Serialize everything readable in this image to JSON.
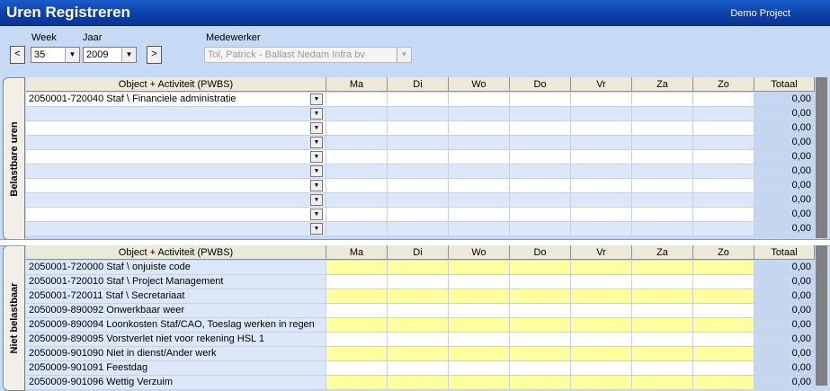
{
  "title": "Uren Registreren",
  "project": "Demo Project",
  "toolbar": {
    "week_label": "Week",
    "week_value": "35",
    "year_label": "Jaar",
    "year_value": "2009",
    "prev_label": "<",
    "next_label": ">",
    "employee_label": "Medewerker",
    "employee_value": "Tol, Patrick - Ballast Nedam Infra bv"
  },
  "columns": [
    "Object + Activiteit (PWBS)",
    "Ma",
    "Di",
    "Wo",
    "Do",
    "Vr",
    "Za",
    "Zo",
    "Totaal"
  ],
  "belastbaar": {
    "tab_label": "Belastbare uren",
    "rows": [
      {
        "object": "2050001-720040  Staf \\ Financiele administratie",
        "total": "0,00"
      },
      {
        "object": "",
        "total": "0,00"
      },
      {
        "object": "",
        "total": "0,00"
      },
      {
        "object": "",
        "total": "0,00"
      },
      {
        "object": "",
        "total": "0,00"
      },
      {
        "object": "",
        "total": "0,00"
      },
      {
        "object": "",
        "total": "0,00"
      },
      {
        "object": "",
        "total": "0,00"
      },
      {
        "object": "",
        "total": "0,00"
      },
      {
        "object": "",
        "total": "0,00"
      }
    ]
  },
  "niet_belastbaar": {
    "tab_label": "Niet belastbaar",
    "rows": [
      {
        "object": "2050001-720000 Staf \\  onjuiste code",
        "total": "0,00"
      },
      {
        "object": "2050001-720010 Staf \\  Project Management",
        "total": "0,00"
      },
      {
        "object": "2050001-720011 Staf \\  Secretariaat",
        "total": "0,00"
      },
      {
        "object": "2050009-890092 Onwerkbaar weer",
        "total": "0,00"
      },
      {
        "object": "2050009-890094 Loonkosten Staf/CAO, Toeslag werken in regen",
        "total": "0,00"
      },
      {
        "object": "2050009-890095  Vorstverlet niet voor rekening HSL 1",
        "total": "0,00"
      },
      {
        "object": "2050009-901090 Niet in dienst/Ander werk",
        "total": "0,00"
      },
      {
        "object": "2050009-901091 Feestdag",
        "total": "0,00"
      },
      {
        "object": "2050009-901096 Wettig Verzuim",
        "total": "0,00"
      }
    ]
  },
  "colors": {
    "titlebar": "#0c3fa8",
    "background": "#c6d9f5",
    "row_alt_blue": "#dce8fa",
    "row_yellow": "#ffff9f",
    "total_column": "#c4d6f0"
  }
}
